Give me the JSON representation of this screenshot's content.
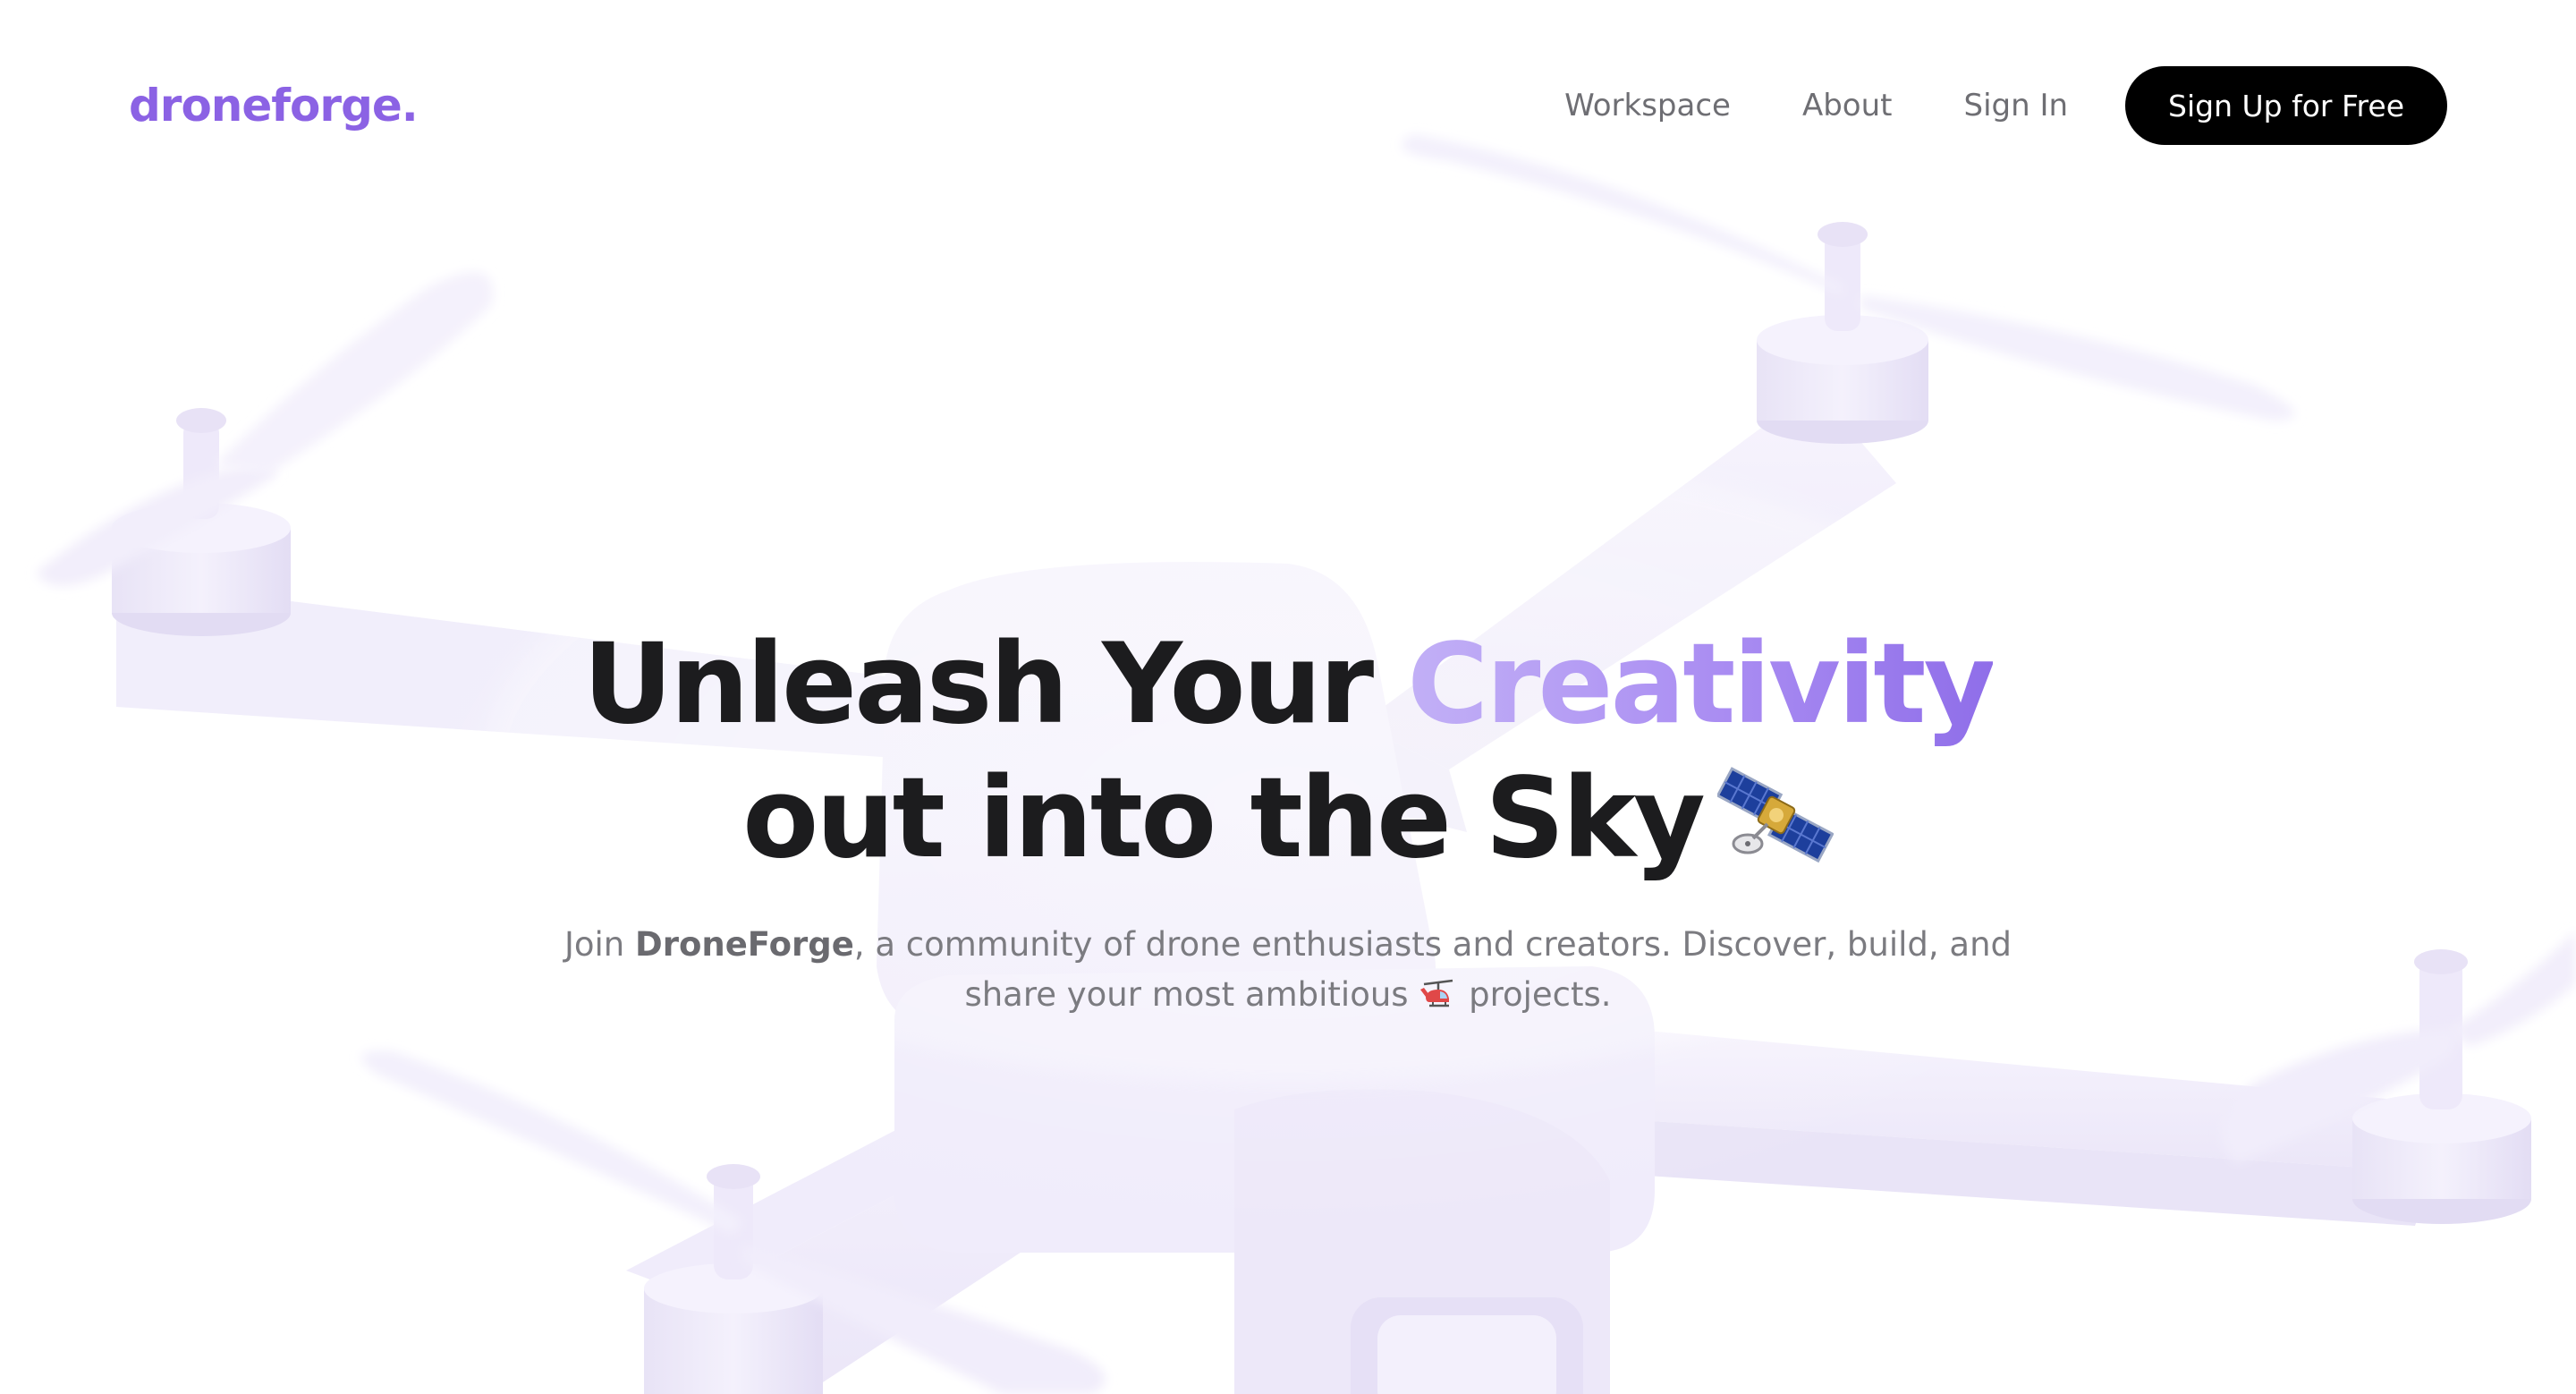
{
  "brand": {
    "logo_text": "droneforge.",
    "accent_color": "#8b62e4"
  },
  "nav": {
    "items": [
      {
        "label": "Workspace"
      },
      {
        "label": "About"
      },
      {
        "label": "Sign In"
      }
    ],
    "cta_label": "Sign Up for Free",
    "cta_color": "#000000"
  },
  "hero": {
    "title_part1": "Unleash Your ",
    "title_accent": "Creativity",
    "title_line2": "out into the Sky",
    "title_icon": "satellite-icon",
    "subtitle_prefix": "Join ",
    "subtitle_brand": "DroneForge",
    "subtitle_middle": ", a community of drone enthusiasts and creators. Discover, build, and share your most ambitious ",
    "subtitle_icon": "helicopter-icon",
    "subtitle_suffix": " projects.",
    "accent_gradient": [
      "#c2b0f6",
      "#8f6ee9"
    ]
  },
  "background": {
    "illustration": "drone-illustration",
    "tint_color": "#efeafb"
  }
}
